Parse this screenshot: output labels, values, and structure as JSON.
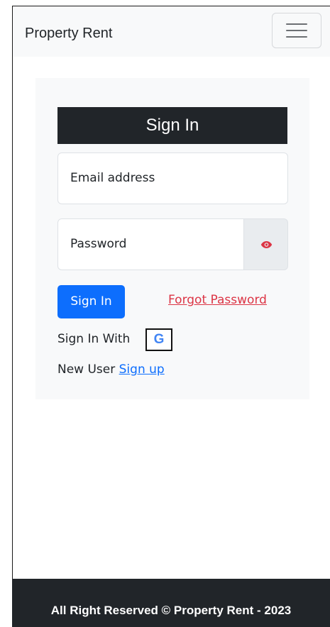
{
  "navbar": {
    "brand": "Property Rent",
    "toggler_icon": "hamburger-icon"
  },
  "form": {
    "title": "Sign In",
    "email_placeholder": "Email address",
    "password_placeholder": "Password",
    "eye_icon": "eye-icon",
    "submit_label": "Sign In",
    "forgot_label": "Forgot Password",
    "signin_with_label": "Sign In With",
    "google_icon_label": "G",
    "new_user_label": "New User",
    "signup_label": "Sign up"
  },
  "footer": {
    "text": "All Right Reserved © Property Rent - 2023"
  },
  "colors": {
    "primary": "#0d6efd",
    "danger": "#dc3545",
    "dark": "#212529",
    "light": "#f8f9fa"
  }
}
